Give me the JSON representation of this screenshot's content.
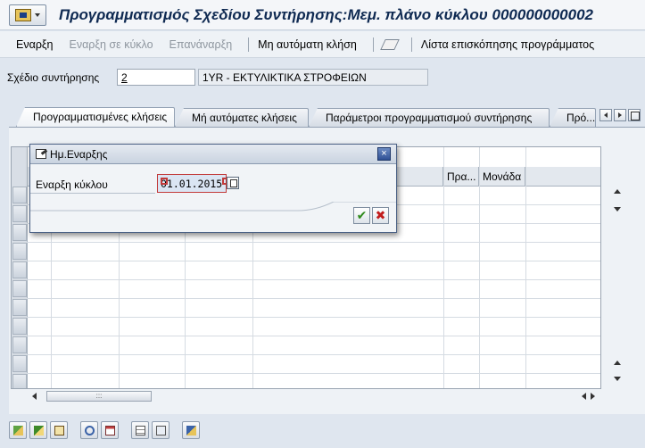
{
  "title": "Προγραμματισμός Σχεδίου Συντήρησης:Μεμ. πλάνο κύκλου 000000000002",
  "toolbar": {
    "start": "Εναρξη",
    "start_in_cycle": "Εναρξη σε κύκλο",
    "restart": "Επανάναρξη",
    "manual_call": "Μη αυτόματη κλήση",
    "schedule_overview": "Λίστα επισκόπησης προγράμματος"
  },
  "field": {
    "label": "Σχέδιο συντήρησης",
    "value": "2",
    "description": "1YR - ΕΚΤΥΛΙΚΤΙΚΑ ΣΤΡΟΦΕΙΩΝ"
  },
  "tabs": [
    {
      "label": "Προγραμματισμένες κλήσεις",
      "active": true
    },
    {
      "label": "Μή αυτόματες κλήσεις",
      "active": false
    },
    {
      "label": "Παράμετροι προγραμματισμού συντήρησης",
      "active": false
    },
    {
      "label": "Πρό...",
      "active": false
    }
  ],
  "table": {
    "headers": [
      "Πρα...",
      "Μονάδα"
    ]
  },
  "dialog": {
    "title": "Ημ.Εναρξης",
    "field_label": "Εναρξη κύκλου",
    "field_value": "01.01.2015",
    "close": "×",
    "ok": "✔",
    "cancel": "✖"
  },
  "icons": [
    "menu-icon",
    "eraser-icon",
    "close-icon",
    "check-icon",
    "cancel-icon",
    "column-config-icon"
  ]
}
